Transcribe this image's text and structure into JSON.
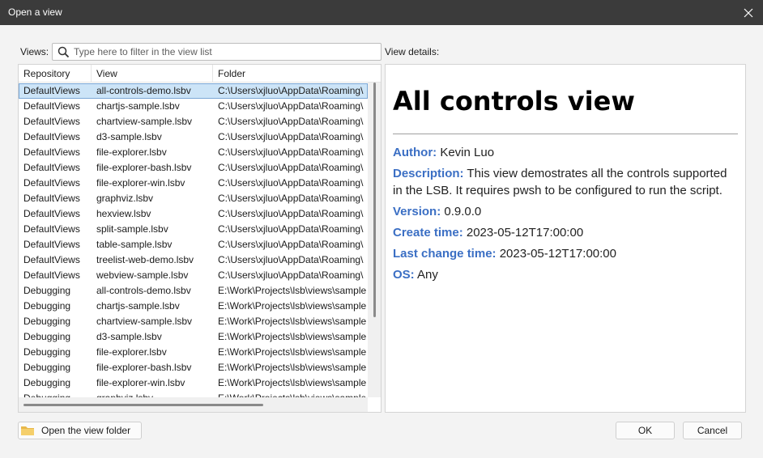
{
  "window": {
    "title": "Open a view"
  },
  "views_label": "Views:",
  "filter": {
    "placeholder": "Type here to filter in the view list",
    "value": ""
  },
  "details_label": "View details:",
  "table": {
    "columns": [
      "Repository",
      "View",
      "Folder"
    ],
    "rows": [
      {
        "repository": "DefaultViews",
        "view": "all-controls-demo.lsbv",
        "folder": "C:\\Users\\xjluo\\AppData\\Roaming\\",
        "selected": true
      },
      {
        "repository": "DefaultViews",
        "view": "chartjs-sample.lsbv",
        "folder": "C:\\Users\\xjluo\\AppData\\Roaming\\"
      },
      {
        "repository": "DefaultViews",
        "view": "chartview-sample.lsbv",
        "folder": "C:\\Users\\xjluo\\AppData\\Roaming\\"
      },
      {
        "repository": "DefaultViews",
        "view": "d3-sample.lsbv",
        "folder": "C:\\Users\\xjluo\\AppData\\Roaming\\"
      },
      {
        "repository": "DefaultViews",
        "view": "file-explorer.lsbv",
        "folder": "C:\\Users\\xjluo\\AppData\\Roaming\\"
      },
      {
        "repository": "DefaultViews",
        "view": "file-explorer-bash.lsbv",
        "folder": "C:\\Users\\xjluo\\AppData\\Roaming\\"
      },
      {
        "repository": "DefaultViews",
        "view": "file-explorer-win.lsbv",
        "folder": "C:\\Users\\xjluo\\AppData\\Roaming\\"
      },
      {
        "repository": "DefaultViews",
        "view": "graphviz.lsbv",
        "folder": "C:\\Users\\xjluo\\AppData\\Roaming\\"
      },
      {
        "repository": "DefaultViews",
        "view": "hexview.lsbv",
        "folder": "C:\\Users\\xjluo\\AppData\\Roaming\\"
      },
      {
        "repository": "DefaultViews",
        "view": "split-sample.lsbv",
        "folder": "C:\\Users\\xjluo\\AppData\\Roaming\\"
      },
      {
        "repository": "DefaultViews",
        "view": "table-sample.lsbv",
        "folder": "C:\\Users\\xjluo\\AppData\\Roaming\\"
      },
      {
        "repository": "DefaultViews",
        "view": "treelist-web-demo.lsbv",
        "folder": "C:\\Users\\xjluo\\AppData\\Roaming\\"
      },
      {
        "repository": "DefaultViews",
        "view": "webview-sample.lsbv",
        "folder": "C:\\Users\\xjluo\\AppData\\Roaming\\"
      },
      {
        "repository": "Debugging",
        "view": "all-controls-demo.lsbv",
        "folder": "E:\\Work\\Projects\\lsb\\views\\sample"
      },
      {
        "repository": "Debugging",
        "view": "chartjs-sample.lsbv",
        "folder": "E:\\Work\\Projects\\lsb\\views\\sample"
      },
      {
        "repository": "Debugging",
        "view": "chartview-sample.lsbv",
        "folder": "E:\\Work\\Projects\\lsb\\views\\sample"
      },
      {
        "repository": "Debugging",
        "view": "d3-sample.lsbv",
        "folder": "E:\\Work\\Projects\\lsb\\views\\sample"
      },
      {
        "repository": "Debugging",
        "view": "file-explorer.lsbv",
        "folder": "E:\\Work\\Projects\\lsb\\views\\sample"
      },
      {
        "repository": "Debugging",
        "view": "file-explorer-bash.lsbv",
        "folder": "E:\\Work\\Projects\\lsb\\views\\sample"
      },
      {
        "repository": "Debugging",
        "view": "file-explorer-win.lsbv",
        "folder": "E:\\Work\\Projects\\lsb\\views\\sample"
      },
      {
        "repository": "Debugging",
        "view": "graphviz.lsbv",
        "folder": "E:\\Work\\Projects\\lsb\\views\\sample"
      }
    ]
  },
  "details": {
    "heading": "All controls view",
    "author_key": "Author:",
    "author": "Kevin Luo",
    "description_key": "Description:",
    "description": "This view demostrates all the controls supported in the LSB. It requires pwsh to be configured to run the script.",
    "version_key": "Version:",
    "version": "0.9.0.0",
    "create_key": "Create time:",
    "create_time": "2023-05-12T17:00:00",
    "change_key": "Last change time:",
    "last_change_time": "2023-05-12T17:00:00",
    "os_key": "OS:",
    "os": "Any"
  },
  "buttons": {
    "open_folder": "Open the view folder",
    "ok": "OK",
    "cancel": "Cancel"
  },
  "icons": {
    "search": "search-icon",
    "close": "close-icon",
    "folder": "folder-icon"
  },
  "colors": {
    "accent": "#3b6fc4",
    "selection": "#cce4f7",
    "titlebar": "#3b3b3b"
  }
}
